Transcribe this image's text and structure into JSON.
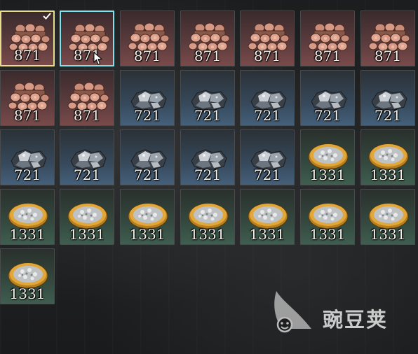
{
  "inventory": {
    "items": [
      {
        "type": "wood",
        "count": "871",
        "icon": "lumber-logs-icon",
        "selected": "yellow"
      },
      {
        "type": "wood",
        "count": "871",
        "icon": "lumber-logs-icon",
        "selected": "cyan"
      },
      {
        "type": "wood",
        "count": "871",
        "icon": "lumber-logs-icon"
      },
      {
        "type": "wood",
        "count": "871",
        "icon": "lumber-logs-icon"
      },
      {
        "type": "wood",
        "count": "871",
        "icon": "lumber-logs-icon"
      },
      {
        "type": "wood",
        "count": "871",
        "icon": "lumber-logs-icon"
      },
      {
        "type": "wood",
        "count": "871",
        "icon": "lumber-logs-icon"
      },
      {
        "type": "wood",
        "count": "871",
        "icon": "lumber-logs-icon"
      },
      {
        "type": "wood",
        "count": "871",
        "icon": "lumber-logs-icon"
      },
      {
        "type": "stone",
        "count": "721",
        "icon": "stone-ore-icon"
      },
      {
        "type": "stone",
        "count": "721",
        "icon": "stone-ore-icon"
      },
      {
        "type": "stone",
        "count": "721",
        "icon": "stone-ore-icon"
      },
      {
        "type": "stone",
        "count": "721",
        "icon": "stone-ore-icon"
      },
      {
        "type": "stone",
        "count": "721",
        "icon": "stone-ore-icon"
      },
      {
        "type": "stone",
        "count": "721",
        "icon": "stone-ore-icon"
      },
      {
        "type": "stone",
        "count": "721",
        "icon": "stone-ore-icon"
      },
      {
        "type": "stone",
        "count": "721",
        "icon": "stone-ore-icon"
      },
      {
        "type": "stone",
        "count": "721",
        "icon": "stone-ore-icon"
      },
      {
        "type": "stone",
        "count": "721",
        "icon": "stone-ore-icon"
      },
      {
        "type": "gold",
        "count": "1331",
        "icon": "silver-plate-icon"
      },
      {
        "type": "gold",
        "count": "1331",
        "icon": "silver-plate-icon"
      },
      {
        "type": "gold",
        "count": "1331",
        "icon": "silver-plate-icon"
      },
      {
        "type": "gold",
        "count": "1331",
        "icon": "silver-plate-icon"
      },
      {
        "type": "gold",
        "count": "1331",
        "icon": "silver-plate-icon"
      },
      {
        "type": "gold",
        "count": "1331",
        "icon": "silver-plate-icon"
      },
      {
        "type": "gold",
        "count": "1331",
        "icon": "silver-plate-icon"
      },
      {
        "type": "gold",
        "count": "1331",
        "icon": "silver-plate-icon"
      },
      {
        "type": "gold",
        "count": "1331",
        "icon": "silver-plate-icon"
      },
      {
        "type": "gold",
        "count": "1331",
        "icon": "silver-plate-icon"
      }
    ]
  },
  "watermark": {
    "text": "豌豆荚",
    "icon": "wandoujia-logo-icon"
  },
  "colors": {
    "select_yellow": "#e8dd8a",
    "select_cyan": "#7fe3ee",
    "wood_bg": "#5a3b3d",
    "stone_bg": "#36495b",
    "gold_bg": "#34493f"
  }
}
